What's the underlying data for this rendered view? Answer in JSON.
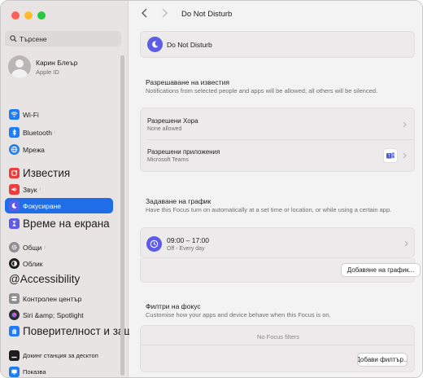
{
  "sidebar": {
    "search": {
      "placeholder": "Търсене"
    },
    "profile": {
      "name": "Карин Блеър",
      "subtitle": "Apple ID"
    },
    "items": [
      {
        "label": "Wi-Fi",
        "icon": "wifi-icon",
        "color": "#1f7cf2"
      },
      {
        "label": "Bluetooth",
        "icon": "bluetooth-icon",
        "color": "#1f7cf2"
      },
      {
        "label": "Мрежа",
        "icon": "globe-icon",
        "color": "#1f7cf2"
      },
      {
        "label": "Известия",
        "icon": "bell-icon",
        "color": "#ee3b3b"
      },
      {
        "label": "Звук",
        "icon": "speaker-icon",
        "color": "#ee3b3b"
      },
      {
        "label": "Фокусиране",
        "icon": "moon-icon",
        "color": "#5e5ce6"
      },
      {
        "label": "Време на екрана",
        "icon": "hourglass-icon",
        "color": "#5e5ce6"
      },
      {
        "label": "Общи",
        "icon": "gear-icon",
        "color": "#8e8e93"
      },
      {
        "label": "Облик",
        "icon": "appearance-icon",
        "color": "#1d1d1f"
      },
      {
        "label": "@Accessibility",
        "icon": "",
        "color": ""
      },
      {
        "label": "Контролен център",
        "icon": "control-center-icon",
        "color": "#8e8e93"
      },
      {
        "label": "Siri &amp; Spotlight",
        "icon": "siri-icon",
        "color": "#2c2c2e"
      },
      {
        "label": "Поверителност и защита",
        "icon": "hand-icon",
        "color": "#1f7cf2"
      },
      {
        "label": "Докинг станция за десктоп",
        "icon": "dock-icon",
        "color": "#1d1d1f"
      },
      {
        "label": "Показва",
        "icon": "display-icon",
        "color": "#1f7cf2"
      }
    ]
  },
  "header": {
    "title": "Do Not Disturb"
  },
  "focus": {
    "name": "Do Not Disturb"
  },
  "allowed": {
    "title": "Разрешаване на известия",
    "description": "Notifications from selected people and apps will be allowed; all others will be silenced.",
    "people": {
      "title": "Разрешени Хора",
      "subtitle": "None allowed"
    },
    "apps": {
      "title": "Разрешени приложения",
      "subtitle": "Microsoft Teams"
    }
  },
  "schedule": {
    "title": "Задаване на график",
    "description": "Have this Focus turn on automatically at a set time or location, or while using a certain app.",
    "entry": {
      "time": "09:00 – 17:00",
      "days": "Off - Every day"
    },
    "add_button": "Добавяне на график..."
  },
  "filters": {
    "title": "Филтри на фокус",
    "description": "Customise how your apps and device behave when this Focus is on.",
    "empty": "No Focus filters",
    "add_button": "Добави филтър..."
  },
  "colors": {
    "accent": "#1f6ee8",
    "focus_purple": "#5e5ce6",
    "teams": "#5059c9"
  }
}
